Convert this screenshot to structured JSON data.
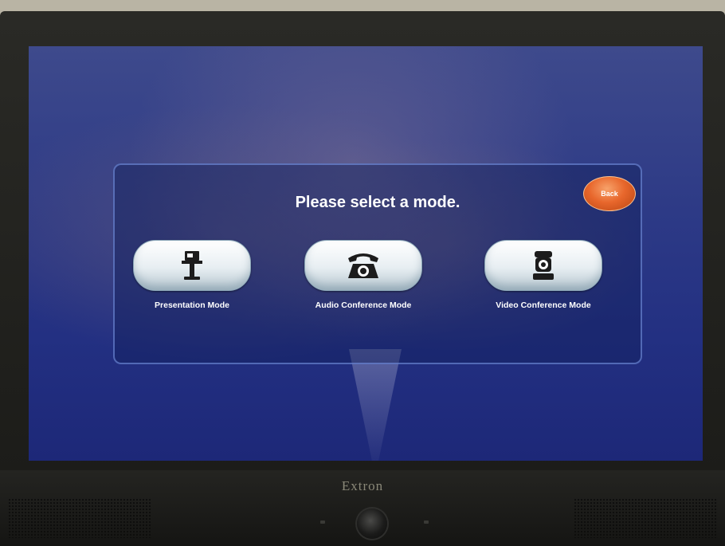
{
  "screen": {
    "title": "Please select a mode.",
    "back_label": "Back",
    "modes": [
      {
        "label": "Presentation Mode",
        "icon": "podium-icon"
      },
      {
        "label": "Audio Conference Mode",
        "icon": "telephone-icon"
      },
      {
        "label": "Video Conference Mode",
        "icon": "camera-icon"
      }
    ]
  },
  "device": {
    "brand": "Extron"
  },
  "colors": {
    "screen_background": "#2d3a86",
    "back_button": "#e8672c",
    "mode_button": "#e7eef2"
  }
}
